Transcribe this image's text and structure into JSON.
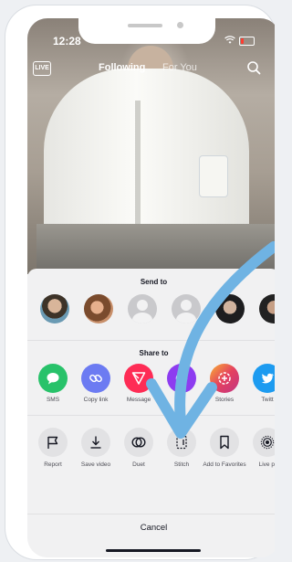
{
  "status_bar": {
    "time": "12:28"
  },
  "top_nav": {
    "live_label": "LIVE",
    "tabs": [
      {
        "label": "Following",
        "active": true
      },
      {
        "label": "For You",
        "active": false
      }
    ]
  },
  "share_sheet": {
    "send_to_title": "Send to",
    "contacts": [
      {
        "kind": "photo"
      },
      {
        "kind": "photo"
      },
      {
        "kind": "placeholder"
      },
      {
        "kind": "placeholder"
      },
      {
        "kind": "photo"
      },
      {
        "kind": "photo"
      }
    ],
    "share_to_title": "Share to",
    "share_targets": [
      {
        "label": "SMS",
        "icon": "sms-icon",
        "color": "#28c26a"
      },
      {
        "label": "Copy link",
        "icon": "link-icon",
        "color": "#6c7bf2"
      },
      {
        "label": "Message",
        "icon": "message-icon",
        "color": "#fe2c55"
      },
      {
        "label": "In",
        "icon": "instagram-direct-icon",
        "color": "#8d3cf0"
      },
      {
        "label": "Stories",
        "icon": "stories-icon",
        "color": "#e4405f"
      },
      {
        "label": "Twitt",
        "icon": "twitter-icon",
        "color": "#1d9bf0"
      }
    ],
    "actions": [
      {
        "label": "Report",
        "icon": "flag-icon"
      },
      {
        "label": "Save video",
        "icon": "download-icon"
      },
      {
        "label": "Duet",
        "icon": "duet-icon"
      },
      {
        "label": "Stitch",
        "icon": "stitch-icon"
      },
      {
        "label": "Add to Favorites",
        "icon": "bookmark-icon"
      },
      {
        "label": "Live pl",
        "icon": "live-photo-icon"
      }
    ],
    "cancel_label": "Cancel"
  },
  "annotation": {
    "arrow_color": "#6fb3e3"
  }
}
